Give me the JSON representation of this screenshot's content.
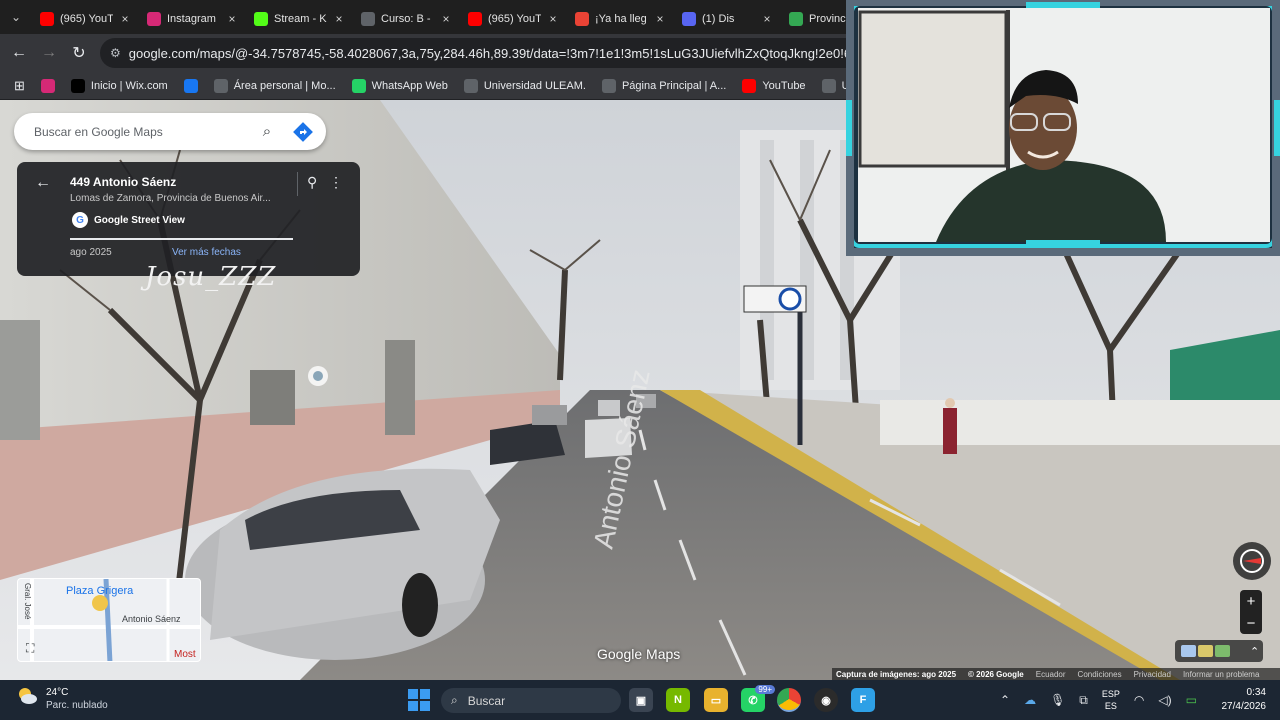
{
  "browser": {
    "tabs": [
      {
        "label": "(965) YouT",
        "icon": "youtube-icon",
        "color": "#ff0000"
      },
      {
        "label": "Instagram",
        "icon": "instagram-icon",
        "color": "#d62976"
      },
      {
        "label": "Stream - K",
        "icon": "kick-icon",
        "color": "#53fc18"
      },
      {
        "label": "Curso: B -",
        "icon": "curso-icon",
        "color": "#5f6368"
      },
      {
        "label": "(965) YouT",
        "icon": "youtube-icon",
        "color": "#ff0000"
      },
      {
        "label": "¡Ya ha lleg",
        "icon": "gmail-icon",
        "color": "#ea4335"
      },
      {
        "label": "(1) Dis",
        "icon": "discord-icon",
        "color": "#5865f2"
      },
      {
        "label": "Provincia",
        "icon": "maps-pin-icon",
        "color": "#34a853"
      }
    ],
    "url": "google.com/maps/@-34.7578745,-58.4028067,3a,75y,284.46h,89.39t/data=!3m7!1e1!3m5!1sLuG3JUiefvlhZxQtoqJkng!2e0!6shttps%3F%2F%2F",
    "bookmarks": [
      {
        "label": "",
        "icon": "instagram-icon",
        "color": "#d62976"
      },
      {
        "label": "Inicio | Wix.com",
        "icon": "wix-icon",
        "color": "#000000"
      },
      {
        "label": "",
        "icon": "facebook-icon",
        "color": "#1877f2"
      },
      {
        "label": "Área personal | Mo...",
        "icon": "moodle-icon",
        "color": "#5f6368"
      },
      {
        "label": "WhatsApp Web",
        "icon": "whatsapp-icon",
        "color": "#25d366"
      },
      {
        "label": "Universidad ULEAM.",
        "icon": "globe-icon",
        "color": "#5f6368"
      },
      {
        "label": "Página Principal | A...",
        "icon": "page-icon",
        "color": "#5f6368"
      },
      {
        "label": "YouTube",
        "icon": "youtube-icon",
        "color": "#ff0000"
      },
      {
        "label": "Unitips | Cursos p",
        "icon": "unitips-icon",
        "color": "#5f6368"
      }
    ]
  },
  "maps": {
    "search_placeholder": "Buscar en Google Maps",
    "place_title": "449 Antonio Sáenz",
    "place_subtitle": "Lomas de Zamora, Provincia de Buenos Air...",
    "source_label": "Google Street View",
    "capture_date": "ago 2025",
    "more_dates": "Ver más fechas",
    "signature": "Josu_ZZZ",
    "street_label": "Antonio Sáenz",
    "watermark": "Google Maps",
    "minimap": {
      "plaza": "Plaza Grigera",
      "street": "Antonio Sáenz",
      "side_street": "Gral. José",
      "bottom_label": "Most"
    },
    "attribution": {
      "capture": "Captura de imágenes: ago 2025",
      "copyright": "© 2026 Google",
      "country": "Ecuador",
      "terms": "Condiciones",
      "privacy": "Privacidad",
      "report": "Informar un problema"
    }
  },
  "taskbar": {
    "weather_temp": "24°C",
    "weather_desc": "Parc. nublado",
    "search_label": "Buscar",
    "whatsapp_badge": "99+",
    "lang_top": "ESP",
    "lang_bottom": "ES",
    "time": "0:34",
    "date": "27/4/2026"
  }
}
